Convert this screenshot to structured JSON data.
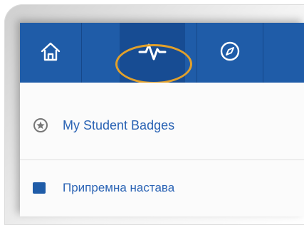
{
  "nav": {
    "items": [
      {
        "icon": "home-icon"
      },
      {
        "icon": "activity-icon",
        "active": true
      },
      {
        "icon": "compass-icon"
      }
    ]
  },
  "menu": {
    "items": [
      {
        "label": "My Student Badges",
        "icon": "star-badge-icon"
      },
      {
        "label": "Припремна настава",
        "icon": "course-square-icon"
      }
    ]
  },
  "colors": {
    "navbar": "#1f5ca8",
    "link": "#2a63b4",
    "highlight": "#e1a02b"
  }
}
